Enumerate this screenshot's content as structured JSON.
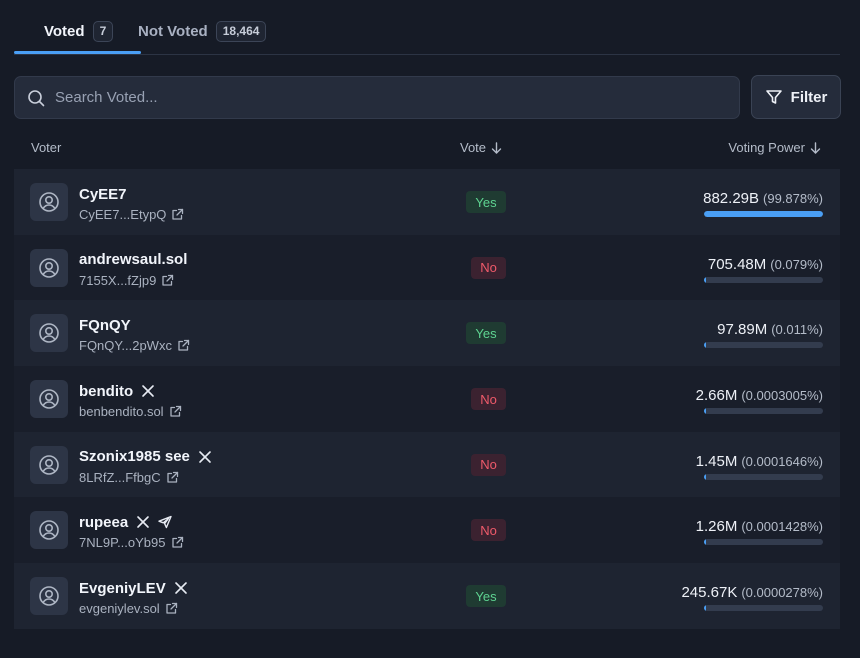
{
  "tabs": [
    {
      "label": "Voted",
      "count": "7"
    },
    {
      "label": "Not Voted",
      "count": "18,464"
    }
  ],
  "search": {
    "placeholder": "Search Voted...",
    "value": ""
  },
  "filter": {
    "label": "Filter"
  },
  "table": {
    "headers": {
      "voter": "Voter",
      "vote": "Vote",
      "power": "Voting Power"
    },
    "rows": [
      {
        "name": "CyEE7",
        "address": "CyEE7...EtypQ",
        "socials": [],
        "vote": "Yes",
        "power": "882.29B",
        "percent": "(99.878%)",
        "fraction": 0.99878
      },
      {
        "name": "andrewsaul.sol",
        "address": "7155X...fZjp9",
        "socials": [],
        "vote": "No",
        "power": "705.48M",
        "percent": "(0.079%)",
        "fraction": 0.00079
      },
      {
        "name": "FQnQY",
        "address": "FQnQY...2pWxc",
        "socials": [],
        "vote": "Yes",
        "power": "97.89M",
        "percent": "(0.011%)",
        "fraction": 0.00011
      },
      {
        "name": "bendito",
        "address": "benbendito.sol",
        "socials": [
          "x-icon"
        ],
        "vote": "No",
        "power": "2.66M",
        "percent": "(0.0003005%)",
        "fraction": 3.005e-06
      },
      {
        "name": "Szonix1985 see",
        "address": "8LRfZ...FfbgC",
        "socials": [
          "x-icon"
        ],
        "vote": "No",
        "power": "1.45M",
        "percent": "(0.0001646%)",
        "fraction": 1.646e-06
      },
      {
        "name": "rupeea",
        "address": "7NL9P...oYb95",
        "socials": [
          "x-icon",
          "telegram-icon"
        ],
        "vote": "No",
        "power": "1.26M",
        "percent": "(0.0001428%)",
        "fraction": 1.428e-06
      },
      {
        "name": "EvgeniyLEV",
        "address": "evgeniylev.sol",
        "socials": [
          "x-icon"
        ],
        "vote": "Yes",
        "power": "245.67K",
        "percent": "(0.0000278%)",
        "fraction": 2.78e-07
      }
    ]
  },
  "colors": {
    "accent": "#4a9ff5",
    "yes": "#5ed391",
    "no": "#ef5a6a"
  }
}
